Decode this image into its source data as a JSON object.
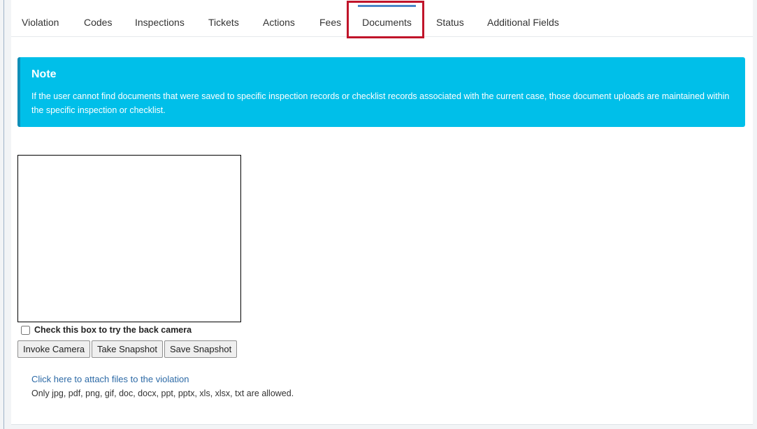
{
  "tabs": [
    {
      "label": "Violation"
    },
    {
      "label": "Codes"
    },
    {
      "label": "Inspections"
    },
    {
      "label": "Tickets"
    },
    {
      "label": "Actions"
    },
    {
      "label": "Fees"
    },
    {
      "label": "Documents",
      "active": true
    },
    {
      "label": "Status"
    },
    {
      "label": "Additional Fields"
    }
  ],
  "note": {
    "title": "Note",
    "text": "If the user cannot find documents that were saved to specific inspection records or checklist records associated with the current case, those document uploads are maintained within the specific inspection or checklist."
  },
  "camera": {
    "back_camera_label": "Check this box to try the back camera",
    "back_camera_checked": false,
    "invoke_label": "Invoke Camera",
    "snapshot_label": "Take Snapshot",
    "save_label": "Save Snapshot"
  },
  "attachments": {
    "link_text": "Click here to attach files to the violation",
    "allowed_text": "Only jpg, pdf, png, gif, doc, docx, ppt, pptx, xls, xlsx, txt are allowed."
  },
  "colors": {
    "note_bg": "#00bfe9",
    "note_border": "#0f8fb8",
    "active_tab_bar": "#4a86c8",
    "highlight_box": "#c0142a",
    "link": "#2d6aa6"
  }
}
